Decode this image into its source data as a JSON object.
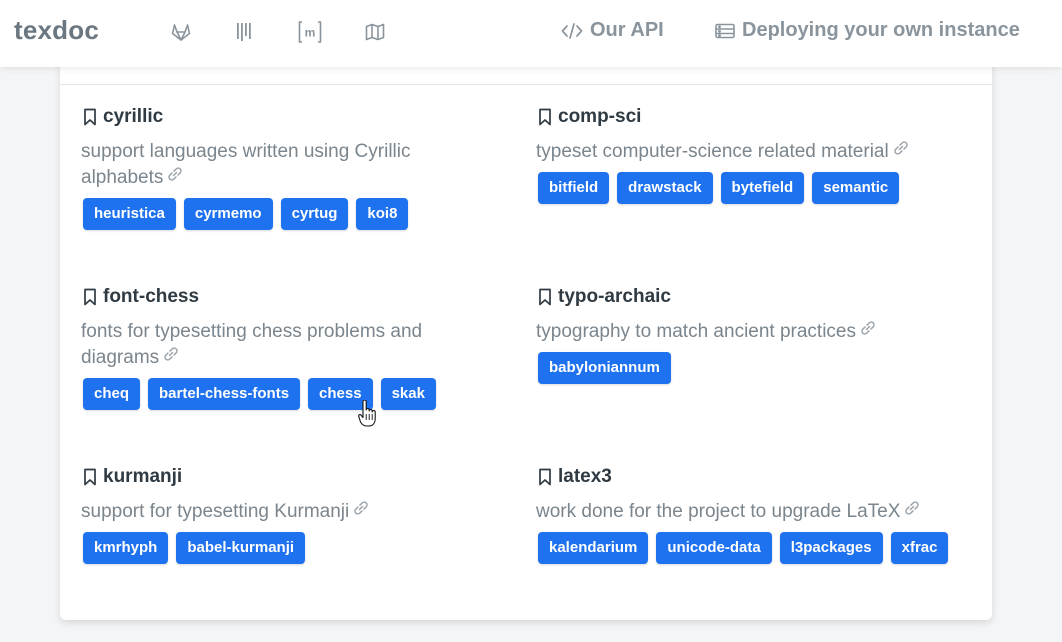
{
  "navbar": {
    "brand": "texdoc",
    "icons": [
      "gitlab-icon",
      "bars-icon",
      "matrix-icon",
      "map-icon"
    ],
    "api_label": "Our API",
    "deploy_label": "Deploying your own instance"
  },
  "topics": [
    {
      "name": "cyrillic",
      "desc_line1": "support languages written using Cyrillic",
      "desc_line2": "alphabets",
      "tags": [
        "heuristica",
        "cyrmemo",
        "cyrtug",
        "koi8"
      ]
    },
    {
      "name": "comp-sci",
      "desc_line1": "typeset computer-science related material",
      "desc_line2": "",
      "tags": [
        "bitfield",
        "drawstack",
        "bytefield",
        "semantic"
      ]
    },
    {
      "name": "font-chess",
      "desc_line1": "fonts for typesetting chess problems and",
      "desc_line2": "diagrams",
      "tags": [
        "cheq",
        "bartel-chess-fonts",
        "chess",
        "skak"
      ]
    },
    {
      "name": "typo-archaic",
      "desc_line1": "typography to match ancient practices",
      "desc_line2": "",
      "tags": [
        "babyloniannum"
      ]
    },
    {
      "name": "kurmanji",
      "desc_line1": "support for typesetting Kurmanji",
      "desc_line2": "",
      "tags": [
        "kmrhyph",
        "babel-kurmanji"
      ]
    },
    {
      "name": "latex3",
      "desc_line1": "work done for the project to upgrade LaTeX",
      "desc_line2": "",
      "tags": [
        "kalendarium",
        "unicode-data",
        "l3packages",
        "xfrac"
      ]
    }
  ],
  "colors": {
    "tag_bg": "#1f72ef",
    "nav_text": "#8a949c",
    "title_text": "#2f3a42",
    "desc_text": "#7a858d"
  }
}
